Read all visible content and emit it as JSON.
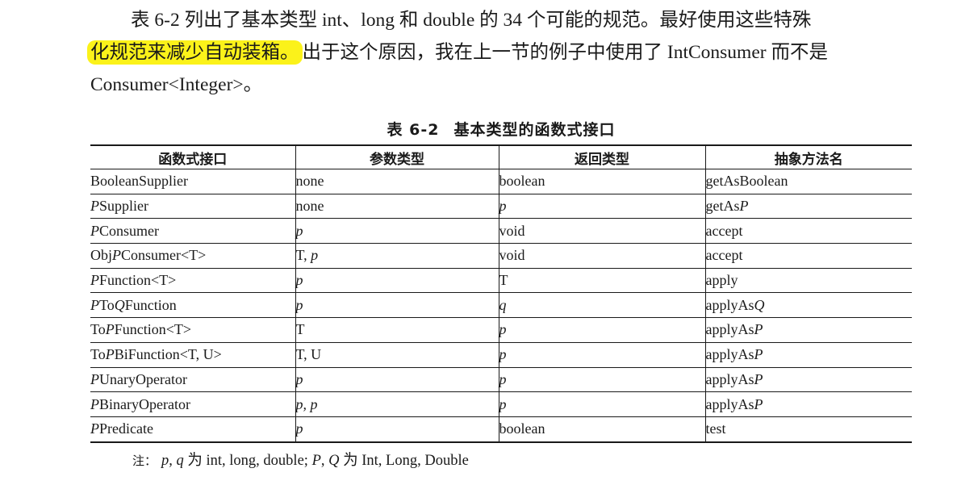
{
  "paragraph": {
    "line1": "表 6-2 列出了基本类型 int、long 和 double 的 34 个可能的规范。最好使用这些特殊",
    "line2_highlight": "化规范来减少自动装箱。",
    "line2_rest": "出于这个原因，我在上一节的例子中使用了 IntConsumer 而不是",
    "line3": "Consumer<Integer>。"
  },
  "table": {
    "caption_number": "表 6-2",
    "caption_title": "基本类型的函数式接口",
    "headers": [
      "函数式接口",
      "参数类型",
      "返回类型",
      "抽象方法名"
    ],
    "rows": [
      {
        "iface": [
          {
            "t": "BooleanSupplier"
          }
        ],
        "param": [
          {
            "t": "none"
          }
        ],
        "ret": [
          {
            "t": "boolean"
          }
        ],
        "meth": [
          {
            "t": "getAsBoolean"
          }
        ]
      },
      {
        "iface": [
          {
            "t": "P",
            "i": true
          },
          {
            "t": "Supplier"
          }
        ],
        "param": [
          {
            "t": "none"
          }
        ],
        "ret": [
          {
            "t": "p",
            "i": true
          }
        ],
        "meth": [
          {
            "t": "getAs"
          },
          {
            "t": "P",
            "i": true
          }
        ]
      },
      {
        "iface": [
          {
            "t": "P",
            "i": true
          },
          {
            "t": "Consumer"
          }
        ],
        "param": [
          {
            "t": "p",
            "i": true
          }
        ],
        "ret": [
          {
            "t": "void"
          }
        ],
        "meth": [
          {
            "t": "accept"
          }
        ]
      },
      {
        "iface": [
          {
            "t": "Obj"
          },
          {
            "t": "P",
            "i": true
          },
          {
            "t": "Consumer<T>"
          }
        ],
        "param": [
          {
            "t": "T, "
          },
          {
            "t": "p",
            "i": true
          }
        ],
        "ret": [
          {
            "t": "void"
          }
        ],
        "meth": [
          {
            "t": "accept"
          }
        ]
      },
      {
        "iface": [
          {
            "t": "P",
            "i": true
          },
          {
            "t": "Function<T>"
          }
        ],
        "param": [
          {
            "t": "p",
            "i": true
          }
        ],
        "ret": [
          {
            "t": "T"
          }
        ],
        "meth": [
          {
            "t": "apply"
          }
        ]
      },
      {
        "iface": [
          {
            "t": "P",
            "i": true
          },
          {
            "t": "To"
          },
          {
            "t": "Q",
            "i": true
          },
          {
            "t": "Function"
          }
        ],
        "param": [
          {
            "t": "p",
            "i": true
          }
        ],
        "ret": [
          {
            "t": "q",
            "i": true
          }
        ],
        "meth": [
          {
            "t": "applyAs"
          },
          {
            "t": "Q",
            "i": true
          }
        ]
      },
      {
        "iface": [
          {
            "t": "To"
          },
          {
            "t": "P",
            "i": true
          },
          {
            "t": "Function<T>"
          }
        ],
        "param": [
          {
            "t": "T"
          }
        ],
        "ret": [
          {
            "t": "p",
            "i": true
          }
        ],
        "meth": [
          {
            "t": "applyAs"
          },
          {
            "t": "P",
            "i": true
          }
        ]
      },
      {
        "iface": [
          {
            "t": "To"
          },
          {
            "t": "P",
            "i": true
          },
          {
            "t": "BiFunction<T, U>"
          }
        ],
        "param": [
          {
            "t": "T, U"
          }
        ],
        "ret": [
          {
            "t": "p",
            "i": true
          }
        ],
        "meth": [
          {
            "t": "applyAs"
          },
          {
            "t": "P",
            "i": true
          }
        ]
      },
      {
        "iface": [
          {
            "t": "P",
            "i": true
          },
          {
            "t": "UnaryOperator"
          }
        ],
        "param": [
          {
            "t": "p",
            "i": true
          }
        ],
        "ret": [
          {
            "t": "p",
            "i": true
          }
        ],
        "meth": [
          {
            "t": "applyAs"
          },
          {
            "t": "P",
            "i": true
          }
        ]
      },
      {
        "iface": [
          {
            "t": "P",
            "i": true
          },
          {
            "t": "BinaryOperator"
          }
        ],
        "param": [
          {
            "t": "p, p",
            "i": true
          }
        ],
        "ret": [
          {
            "t": "p",
            "i": true
          }
        ],
        "meth": [
          {
            "t": "applyAs"
          },
          {
            "t": "P",
            "i": true
          }
        ]
      },
      {
        "iface": [
          {
            "t": "P",
            "i": true
          },
          {
            "t": "Predicate"
          }
        ],
        "param": [
          {
            "t": "p",
            "i": true
          }
        ],
        "ret": [
          {
            "t": "boolean"
          }
        ],
        "meth": [
          {
            "t": "test"
          }
        ]
      }
    ]
  },
  "note": {
    "label": "注：",
    "parts": [
      {
        "t": "p",
        "i": true
      },
      {
        "t": ", "
      },
      {
        "t": "q",
        "i": true
      },
      {
        "t": " 为 int, long, double; "
      },
      {
        "t": "P",
        "i": true
      },
      {
        "t": ", "
      },
      {
        "t": "Q",
        "i": true
      },
      {
        "t": " 为 Int, Long, Double"
      }
    ]
  },
  "colors": {
    "highlight": "#fbf21a",
    "text": "#1a1a1a",
    "rule": "#1a1a1a"
  }
}
